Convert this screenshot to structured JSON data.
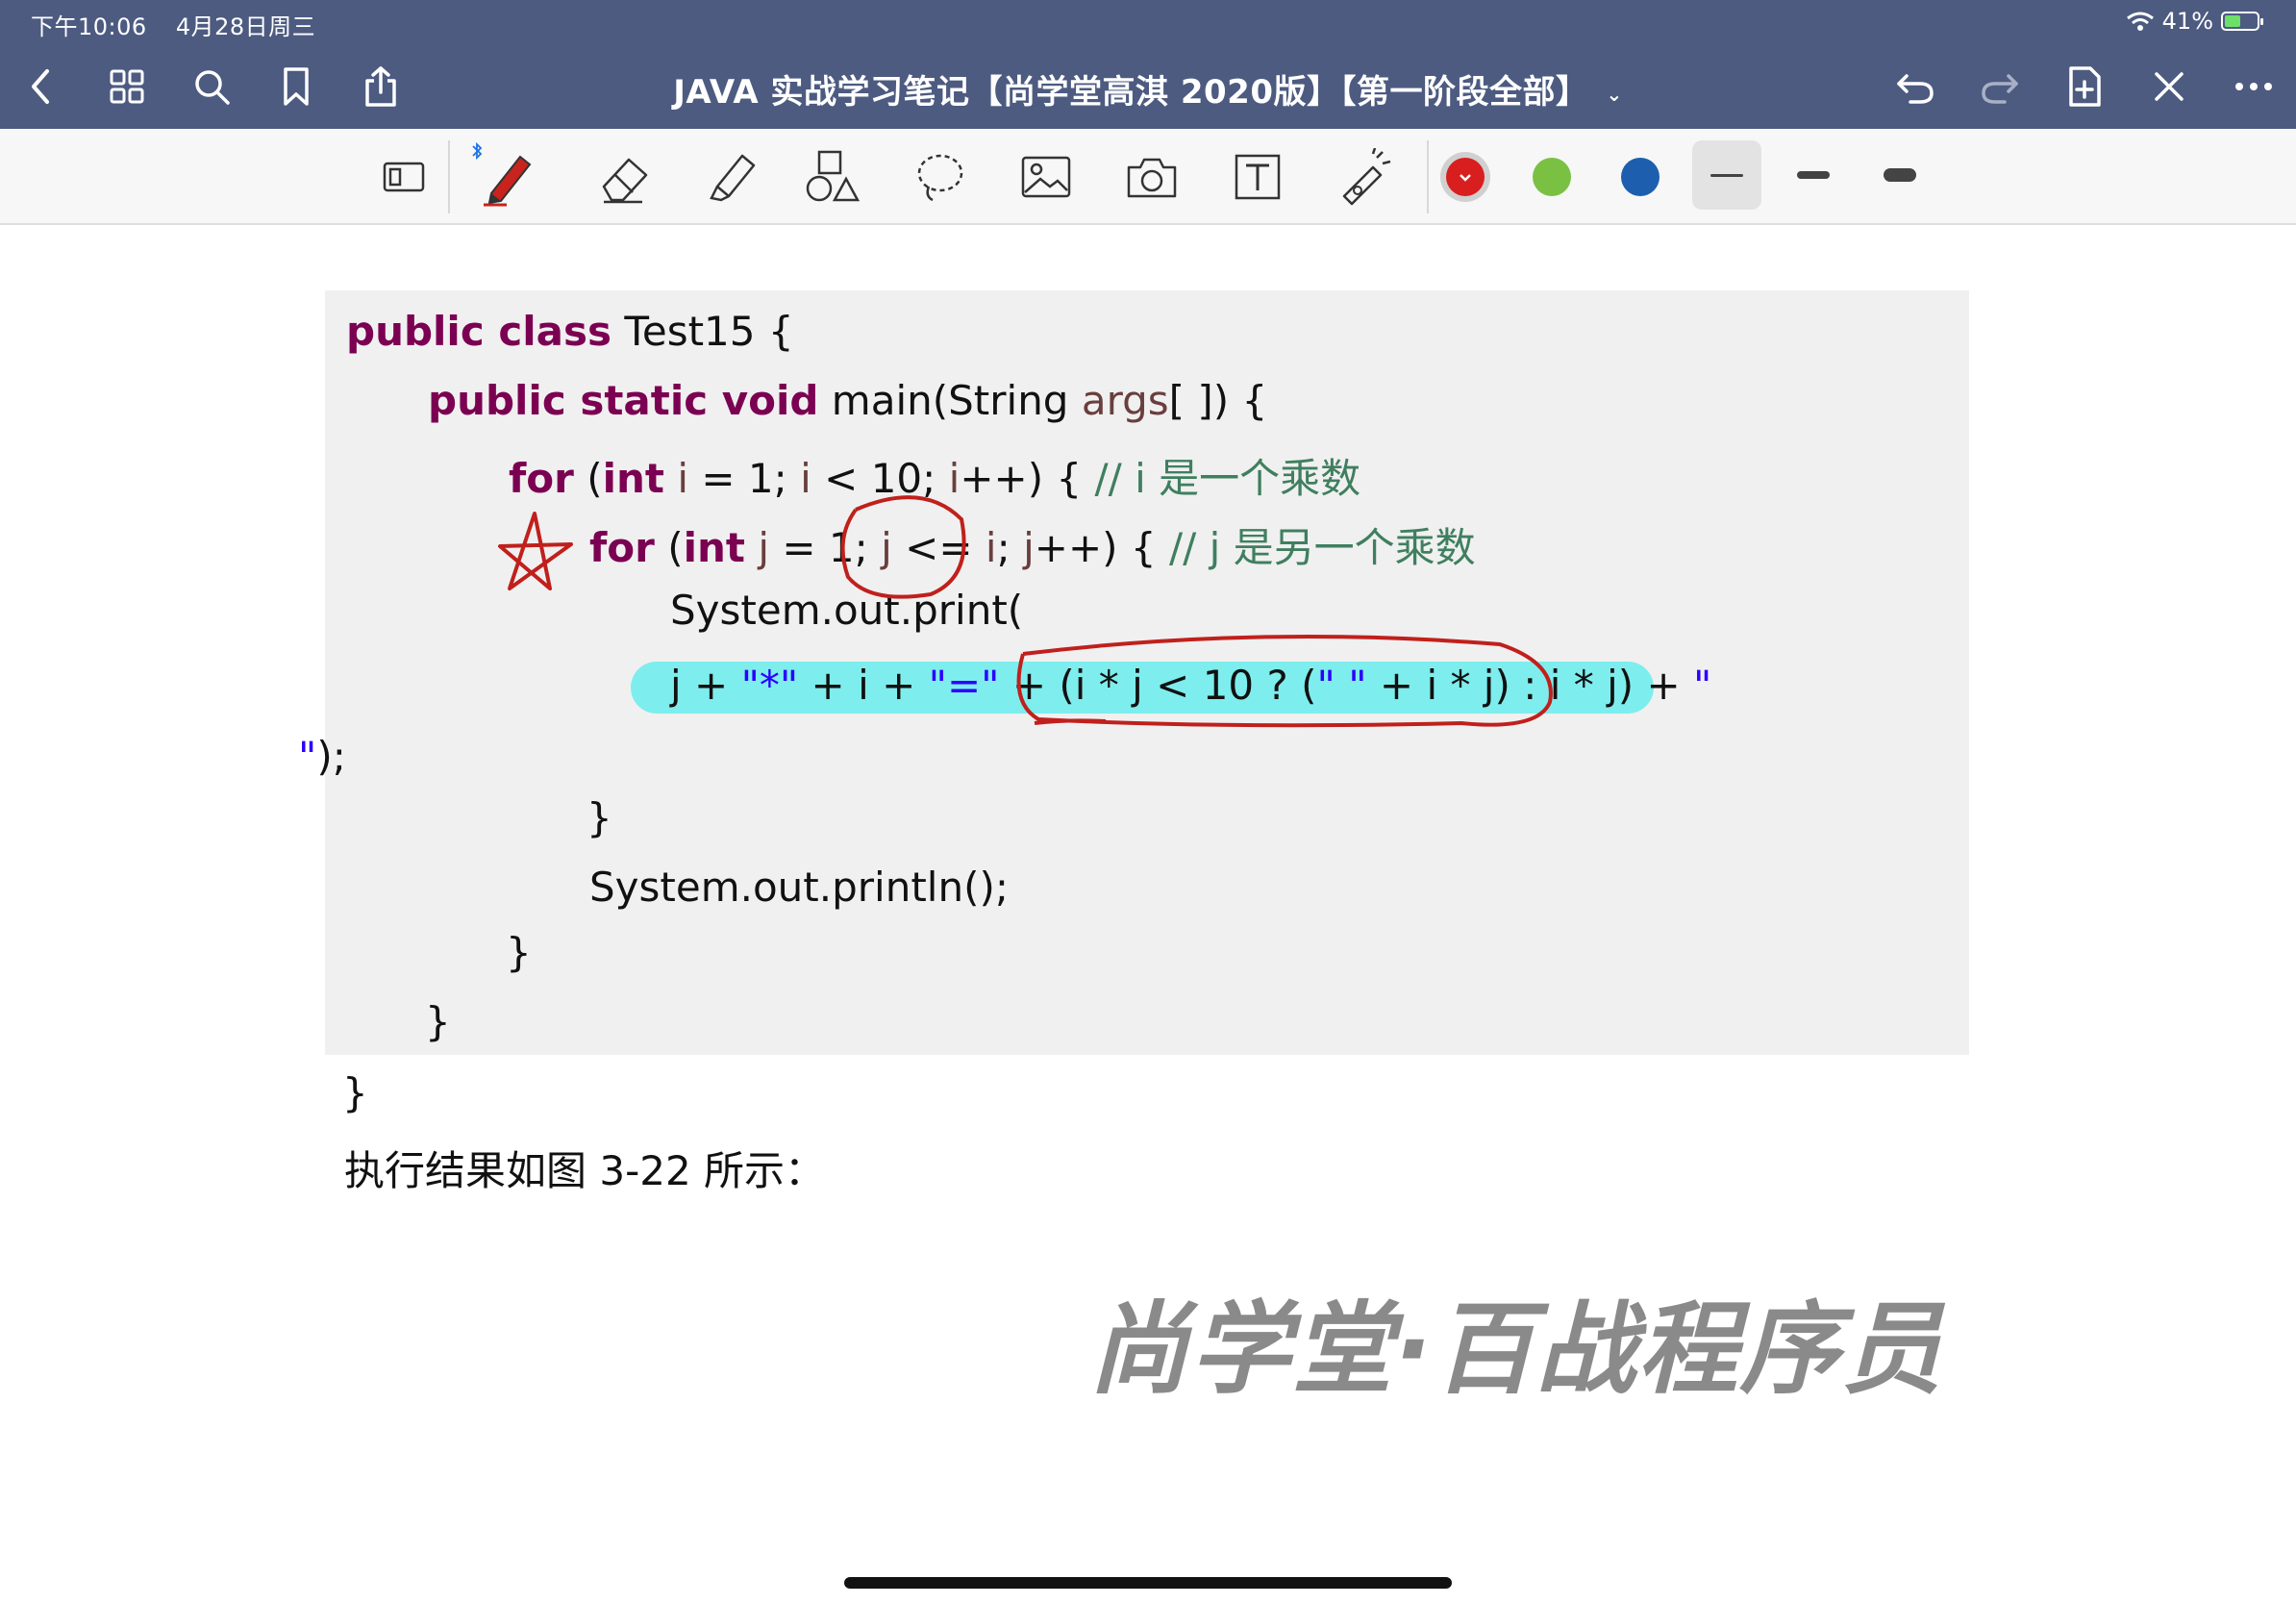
{
  "status_bar": {
    "time": "下午10:06",
    "date": "4月28日周三",
    "battery": "41%",
    "battery_level": 0.41
  },
  "nav": {
    "title": "JAVA 实战学习笔记【尚学堂高淇 2020版】【第一阶段全部】",
    "back_icon": "chevron-left-icon",
    "grid_icon": "grid-icon",
    "search_icon": "search-icon",
    "bookmark_icon": "bookmark-icon",
    "share_icon": "share-icon",
    "undo_icon": "undo-icon",
    "redo_icon": "redo-icon",
    "add_page_icon": "add-page-icon",
    "close_icon": "close-icon",
    "more_icon": "more-icon"
  },
  "toolbar": {
    "tools": [
      "page-view-icon",
      "pen-icon",
      "eraser-icon",
      "highlighter-icon",
      "shapes-icon",
      "lasso-icon",
      "image-icon",
      "camera-icon",
      "text-icon",
      "laser-pointer-icon"
    ],
    "colors": [
      "#d81e1e",
      "#7ac143",
      "#1d5fae"
    ],
    "selected_color": "#d81e1e",
    "selected_width": "thin"
  },
  "code": {
    "line1": {
      "kw": "public class",
      "rest": " Test15 {"
    },
    "line2": {
      "kw": "public static void",
      "rest1": " main(String ",
      "var": "args",
      "rest2": "[ ]) {"
    },
    "line3": {
      "kw1": "for",
      "p1": " (",
      "kw2": "int",
      "sp": " ",
      "v1": "i",
      "t1": " = 1; ",
      "v2": "i",
      "t2": " < 10; ",
      "v3": "i",
      "t3": "++) { ",
      "comment": "// i 是一个乘数"
    },
    "line4": {
      "kw1": "for",
      "p1": " (",
      "kw2": "int",
      "sp": " ",
      "v1": "j",
      "t1": " = 1; ",
      "v2": "j",
      "t2": " <= ",
      "v3": "i",
      "t3": "; ",
      "v4": "j",
      "t4": "++) { ",
      "comment": "// j 是另一个乘数"
    },
    "line5": "System.out.print(",
    "line6": {
      "a": "j + ",
      "s1": "\"*\"",
      "b": " + i + ",
      "s2": "\"=\"",
      "c": " + (i * j < 10 ? (",
      "s3": "\" \"",
      "d": " + i * j) : i * j) + ",
      "s4": "\""
    },
    "line7": {
      "s": "\"",
      "rest": ");"
    },
    "line8": "}",
    "line9": "System.out.println();",
    "line10": "}",
    "line11": "}",
    "line12": "}"
  },
  "caption": "执行结果如图 3-22 所示：",
  "watermark": "尚学堂·百战程序员"
}
